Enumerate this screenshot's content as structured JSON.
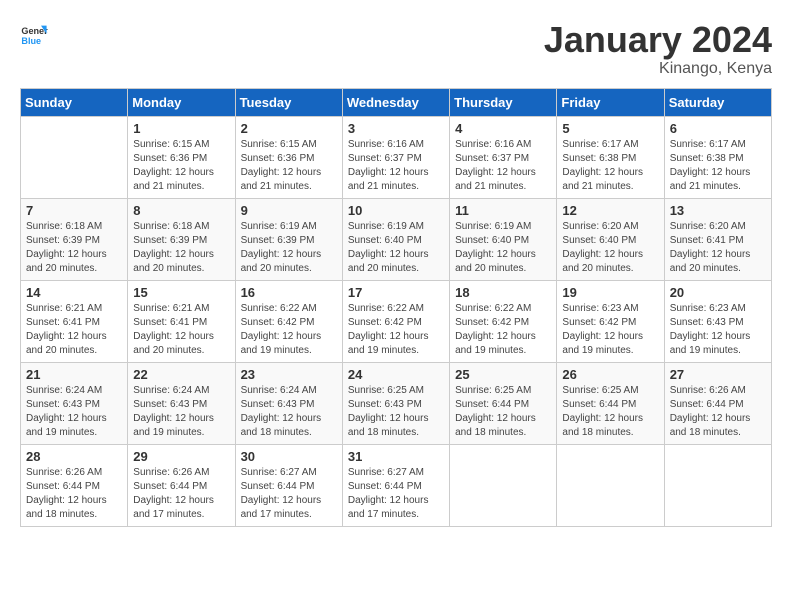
{
  "header": {
    "logo_general": "General",
    "logo_blue": "Blue",
    "month_year": "January 2024",
    "location": "Kinango, Kenya"
  },
  "columns": [
    "Sunday",
    "Monday",
    "Tuesday",
    "Wednesday",
    "Thursday",
    "Friday",
    "Saturday"
  ],
  "weeks": [
    [
      {
        "day": "",
        "info": ""
      },
      {
        "day": "1",
        "info": "Sunrise: 6:15 AM\nSunset: 6:36 PM\nDaylight: 12 hours and 21 minutes."
      },
      {
        "day": "2",
        "info": "Sunrise: 6:15 AM\nSunset: 6:36 PM\nDaylight: 12 hours and 21 minutes."
      },
      {
        "day": "3",
        "info": "Sunrise: 6:16 AM\nSunset: 6:37 PM\nDaylight: 12 hours and 21 minutes."
      },
      {
        "day": "4",
        "info": "Sunrise: 6:16 AM\nSunset: 6:37 PM\nDaylight: 12 hours and 21 minutes."
      },
      {
        "day": "5",
        "info": "Sunrise: 6:17 AM\nSunset: 6:38 PM\nDaylight: 12 hours and 21 minutes."
      },
      {
        "day": "6",
        "info": "Sunrise: 6:17 AM\nSunset: 6:38 PM\nDaylight: 12 hours and 21 minutes."
      }
    ],
    [
      {
        "day": "7",
        "info": "Sunrise: 6:18 AM\nSunset: 6:39 PM\nDaylight: 12 hours and 20 minutes."
      },
      {
        "day": "8",
        "info": "Sunrise: 6:18 AM\nSunset: 6:39 PM\nDaylight: 12 hours and 20 minutes."
      },
      {
        "day": "9",
        "info": "Sunrise: 6:19 AM\nSunset: 6:39 PM\nDaylight: 12 hours and 20 minutes."
      },
      {
        "day": "10",
        "info": "Sunrise: 6:19 AM\nSunset: 6:40 PM\nDaylight: 12 hours and 20 minutes."
      },
      {
        "day": "11",
        "info": "Sunrise: 6:19 AM\nSunset: 6:40 PM\nDaylight: 12 hours and 20 minutes."
      },
      {
        "day": "12",
        "info": "Sunrise: 6:20 AM\nSunset: 6:40 PM\nDaylight: 12 hours and 20 minutes."
      },
      {
        "day": "13",
        "info": "Sunrise: 6:20 AM\nSunset: 6:41 PM\nDaylight: 12 hours and 20 minutes."
      }
    ],
    [
      {
        "day": "14",
        "info": "Sunrise: 6:21 AM\nSunset: 6:41 PM\nDaylight: 12 hours and 20 minutes."
      },
      {
        "day": "15",
        "info": "Sunrise: 6:21 AM\nSunset: 6:41 PM\nDaylight: 12 hours and 20 minutes."
      },
      {
        "day": "16",
        "info": "Sunrise: 6:22 AM\nSunset: 6:42 PM\nDaylight: 12 hours and 19 minutes."
      },
      {
        "day": "17",
        "info": "Sunrise: 6:22 AM\nSunset: 6:42 PM\nDaylight: 12 hours and 19 minutes."
      },
      {
        "day": "18",
        "info": "Sunrise: 6:22 AM\nSunset: 6:42 PM\nDaylight: 12 hours and 19 minutes."
      },
      {
        "day": "19",
        "info": "Sunrise: 6:23 AM\nSunset: 6:42 PM\nDaylight: 12 hours and 19 minutes."
      },
      {
        "day": "20",
        "info": "Sunrise: 6:23 AM\nSunset: 6:43 PM\nDaylight: 12 hours and 19 minutes."
      }
    ],
    [
      {
        "day": "21",
        "info": "Sunrise: 6:24 AM\nSunset: 6:43 PM\nDaylight: 12 hours and 19 minutes."
      },
      {
        "day": "22",
        "info": "Sunrise: 6:24 AM\nSunset: 6:43 PM\nDaylight: 12 hours and 19 minutes."
      },
      {
        "day": "23",
        "info": "Sunrise: 6:24 AM\nSunset: 6:43 PM\nDaylight: 12 hours and 18 minutes."
      },
      {
        "day": "24",
        "info": "Sunrise: 6:25 AM\nSunset: 6:43 PM\nDaylight: 12 hours and 18 minutes."
      },
      {
        "day": "25",
        "info": "Sunrise: 6:25 AM\nSunset: 6:44 PM\nDaylight: 12 hours and 18 minutes."
      },
      {
        "day": "26",
        "info": "Sunrise: 6:25 AM\nSunset: 6:44 PM\nDaylight: 12 hours and 18 minutes."
      },
      {
        "day": "27",
        "info": "Sunrise: 6:26 AM\nSunset: 6:44 PM\nDaylight: 12 hours and 18 minutes."
      }
    ],
    [
      {
        "day": "28",
        "info": "Sunrise: 6:26 AM\nSunset: 6:44 PM\nDaylight: 12 hours and 18 minutes."
      },
      {
        "day": "29",
        "info": "Sunrise: 6:26 AM\nSunset: 6:44 PM\nDaylight: 12 hours and 17 minutes."
      },
      {
        "day": "30",
        "info": "Sunrise: 6:27 AM\nSunset: 6:44 PM\nDaylight: 12 hours and 17 minutes."
      },
      {
        "day": "31",
        "info": "Sunrise: 6:27 AM\nSunset: 6:44 PM\nDaylight: 12 hours and 17 minutes."
      },
      {
        "day": "",
        "info": ""
      },
      {
        "day": "",
        "info": ""
      },
      {
        "day": "",
        "info": ""
      }
    ]
  ]
}
